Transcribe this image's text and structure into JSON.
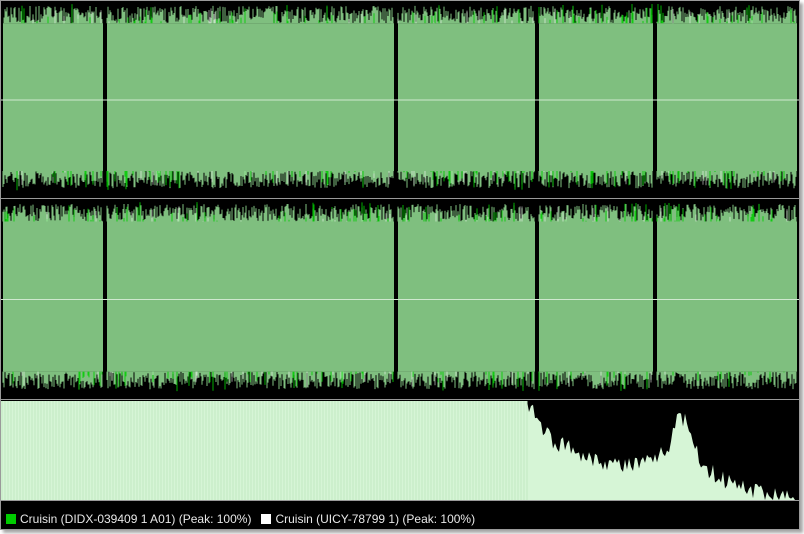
{
  "colors": {
    "background": "#000000",
    "track_a": "#00cc00",
    "track_b": "#ffffff",
    "overlap": "#7fbf7f",
    "spectrum": "#d6f5d6",
    "center_line": "#cfe8cf",
    "separator": "#9a9a9a"
  },
  "waveform": {
    "channels": 2,
    "segment_boundaries": [
      0.0,
      0.13,
      0.495,
      0.672,
      0.82,
      1.0
    ]
  },
  "spectrum": {
    "profile": [
      [
        0.0,
        1.0
      ],
      [
        0.66,
        1.0
      ],
      [
        0.67,
        0.85
      ],
      [
        0.69,
        0.6
      ],
      [
        0.72,
        0.5
      ],
      [
        0.75,
        0.4
      ],
      [
        0.78,
        0.35
      ],
      [
        0.82,
        0.38
      ],
      [
        0.84,
        0.6
      ],
      [
        0.85,
        0.9
      ],
      [
        0.86,
        0.75
      ],
      [
        0.88,
        0.35
      ],
      [
        0.9,
        0.22
      ],
      [
        0.93,
        0.12
      ],
      [
        0.96,
        0.07
      ],
      [
        1.0,
        0.02
      ]
    ]
  },
  "legend": [
    {
      "label": "Cruisin (DIDX-039409 1 A01) (Peak: 100%)",
      "color": "#00cc00"
    },
    {
      "label": "Cruisin (UICY-78799 1) (Peak: 100%)",
      "color": "#ffffff"
    }
  ]
}
